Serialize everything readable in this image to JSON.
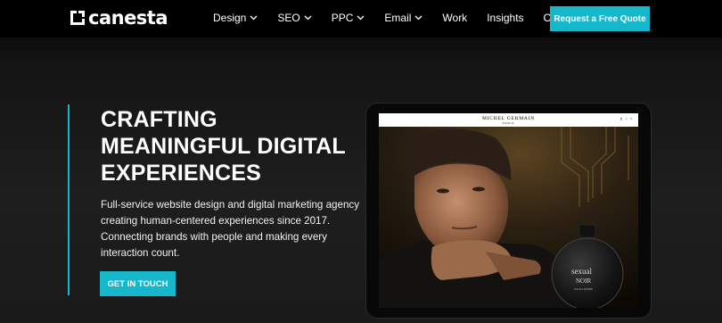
{
  "nav": {
    "brand": "canesta",
    "items": [
      {
        "label": "Design",
        "dropdown": true
      },
      {
        "label": "SEO",
        "dropdown": true
      },
      {
        "label": "PPC",
        "dropdown": true
      },
      {
        "label": "Email",
        "dropdown": true
      },
      {
        "label": "Work",
        "dropdown": false
      },
      {
        "label": "Insights",
        "dropdown": false
      },
      {
        "label": "Contact",
        "dropdown": false
      }
    ],
    "cta_label": "Request a Free Quote"
  },
  "hero": {
    "title_lines": [
      "CRAFTING",
      "MEANINGFUL DIGITAL",
      "EXPERIENCES"
    ],
    "desc_lines": [
      "Full-service website design and digital marketing agency",
      "creating human-centered experiences since 2017.",
      "Connecting brands with people and making every",
      "interaction count."
    ],
    "cta_label": "GET IN TOUCH"
  },
  "showcase": {
    "site_brand": "MICHEL GERMAIN",
    "site_brand_sub": "PARIS",
    "icons": [
      "search-icon",
      "user-icon",
      "bag-icon"
    ],
    "bottle_text_1": "sexual",
    "bottle_text_2": "NOIR",
    "bottle_text_3": "POUR HOMME"
  },
  "colors": {
    "accent": "#16b6cb",
    "nav_bg": "#000000",
    "page_bg": "#1a1a1a"
  }
}
